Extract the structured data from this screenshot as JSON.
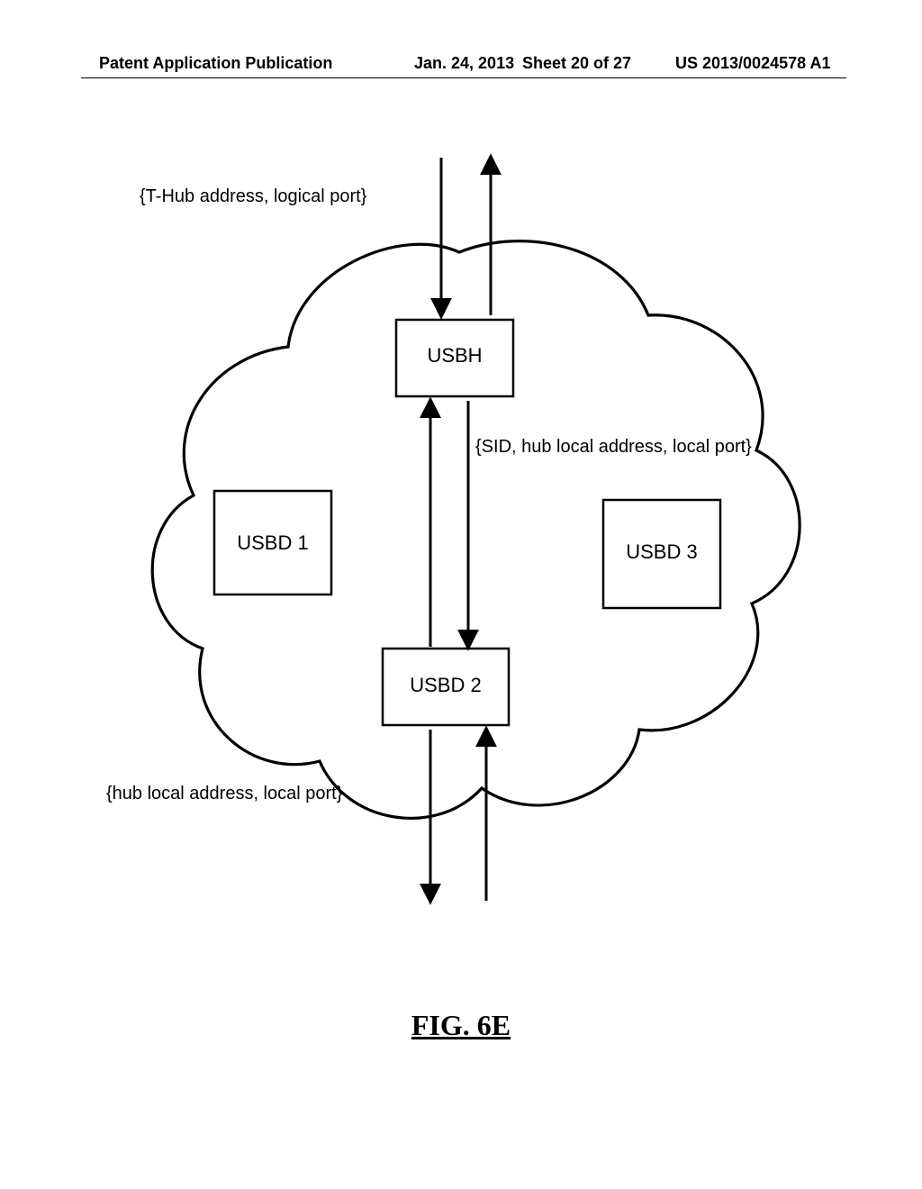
{
  "header": {
    "left": "Patent Application Publication",
    "date": "Jan. 24, 2013",
    "sheet": "Sheet 20 of 27",
    "num": "US 2013/0024578 A1"
  },
  "labels": {
    "top": "{T-Hub address, logical port}",
    "mid": "{SID, hub local address, local port}",
    "bottom": "{hub local address, local port}"
  },
  "boxes": {
    "usbh": "USBH",
    "usbd1": "USBD 1",
    "usbd2": "USBD 2",
    "usbd3": "USBD 3"
  },
  "figure_caption": "FIG. 6E"
}
